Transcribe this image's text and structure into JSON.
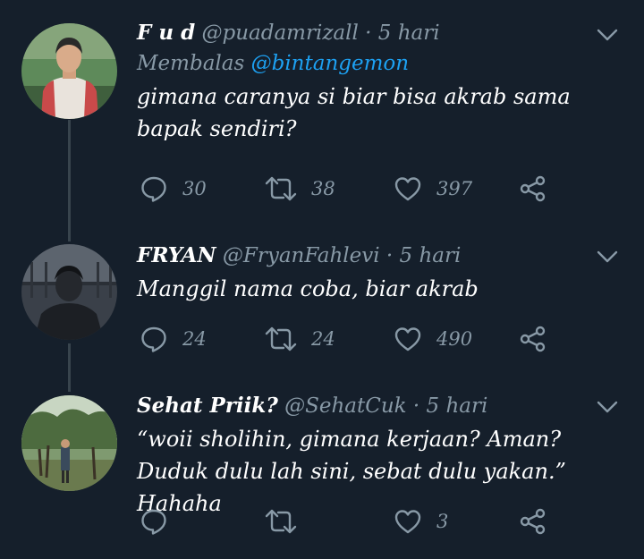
{
  "tweets": [
    {
      "display_name": "F u d",
      "handle": "@puadamrizall",
      "separator": "·",
      "time": "5 hari",
      "reply_prefix": "Membalas",
      "reply_to": "@bintangemon",
      "text": "gimana caranya si biar bisa akrab sama bapak sendiri?",
      "replies": "30",
      "retweets": "38",
      "likes": "397"
    },
    {
      "display_name": "FRYAN",
      "handle": "@FryanFahlevi",
      "separator": "·",
      "time": "5 hari",
      "text": "Manggil nama coba, biar akrab",
      "replies": "24",
      "retweets": "24",
      "likes": "490"
    },
    {
      "display_name": "Sehat Priik?",
      "handle": "@SehatCuk",
      "separator": "·",
      "time": "5 hari",
      "text": "“woii sholihin, gimana kerjaan? Aman? Duduk dulu lah sini, sebat dulu yakan.” Hahaha",
      "replies": "",
      "retweets": "",
      "likes": "3"
    }
  ],
  "icons": {
    "reply": "reply-icon",
    "retweet": "retweet-icon",
    "like": "heart-icon",
    "share": "share-icon",
    "more": "chevron-down-icon"
  },
  "colors": {
    "background": "#151f2b",
    "text_primary": "#ffffff",
    "text_secondary": "#8899a6",
    "mention": "#1da1f2",
    "thread_line": "#38444d"
  }
}
